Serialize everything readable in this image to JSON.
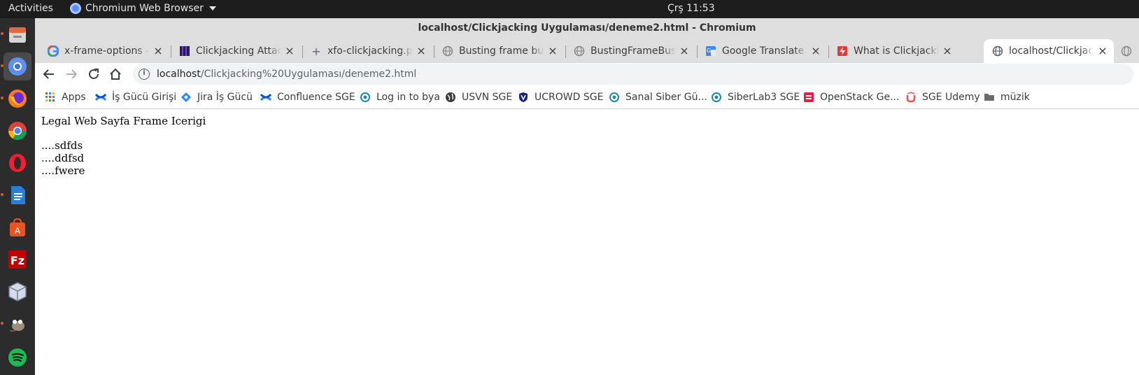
{
  "topbar": {
    "activities": "Activities",
    "app_name": "Chromium Web Browser",
    "clock": "Çrş 11:53"
  },
  "dock": {
    "items": [
      {
        "icon": "files-icon"
      },
      {
        "icon": "chromium-icon"
      },
      {
        "icon": "firefox-icon"
      },
      {
        "icon": "chrome-icon"
      },
      {
        "icon": "opera-icon"
      },
      {
        "icon": "writer-icon"
      },
      {
        "icon": "software-icon"
      },
      {
        "icon": "filezilla-icon"
      },
      {
        "icon": "virtualbox-icon"
      },
      {
        "icon": "gimp-icon"
      },
      {
        "icon": "spotify-icon"
      }
    ]
  },
  "window": {
    "title": "localhost/Clickjacking Uygulaması/deneme2.html - Chromium"
  },
  "tabs": [
    {
      "label": "x-frame-options - Google Search",
      "icon": "google-icon"
    },
    {
      "label": "Clickjacking Attacks",
      "icon": "stripe-icon"
    },
    {
      "label": "xfo-clickjacking.pdf",
      "icon": "plus-icon"
    },
    {
      "label": "Busting frame busting",
      "icon": "globe-icon"
    },
    {
      "label": "BustingFrameBusting",
      "icon": "globe-icon"
    },
    {
      "label": "Google Translate",
      "icon": "translate-icon"
    },
    {
      "label": "What is Clickjacking",
      "icon": "bolt-icon"
    },
    {
      "label": "localhost/Clickjacking",
      "icon": "globe-icon",
      "active": true
    }
  ],
  "omnibox": {
    "host": "localhost",
    "path": "/Clickjacking%20Uygulaması/deneme2.html"
  },
  "bookmarks": [
    {
      "label": "Apps",
      "icon": "apps-grid-icon"
    },
    {
      "label": "İş Gücü Girişi",
      "icon": "confluence-icon"
    },
    {
      "label": "Jira İş Gücü",
      "icon": "jira-icon"
    },
    {
      "label": "Confluence SGE",
      "icon": "confluence-icon"
    },
    {
      "label": "Log in to bya",
      "icon": "bya-icon"
    },
    {
      "label": "USVN SGE",
      "icon": "globe-dark-icon"
    },
    {
      "label": "UCROWD SGE",
      "icon": "shield-icon"
    },
    {
      "label": "Sanal Siber Gü...",
      "icon": "bya-icon"
    },
    {
      "label": "SiberLab3 SGE",
      "icon": "bya-icon"
    },
    {
      "label": "OpenStack Ge...",
      "icon": "openstack-icon"
    },
    {
      "label": "SGE Udemy",
      "icon": "udemy-icon"
    },
    {
      "label": "müzik",
      "icon": "folder-icon"
    }
  ],
  "page": {
    "heading": "Legal Web Sayfa Frame Icerigi",
    "lines": [
      "....sdfds",
      "....ddfsd",
      "....fwere"
    ]
  },
  "colors": {
    "accent_dot": "#e95420",
    "chrome_frame": "#dedede",
    "omnibox_bg": "#f1f3f4"
  }
}
